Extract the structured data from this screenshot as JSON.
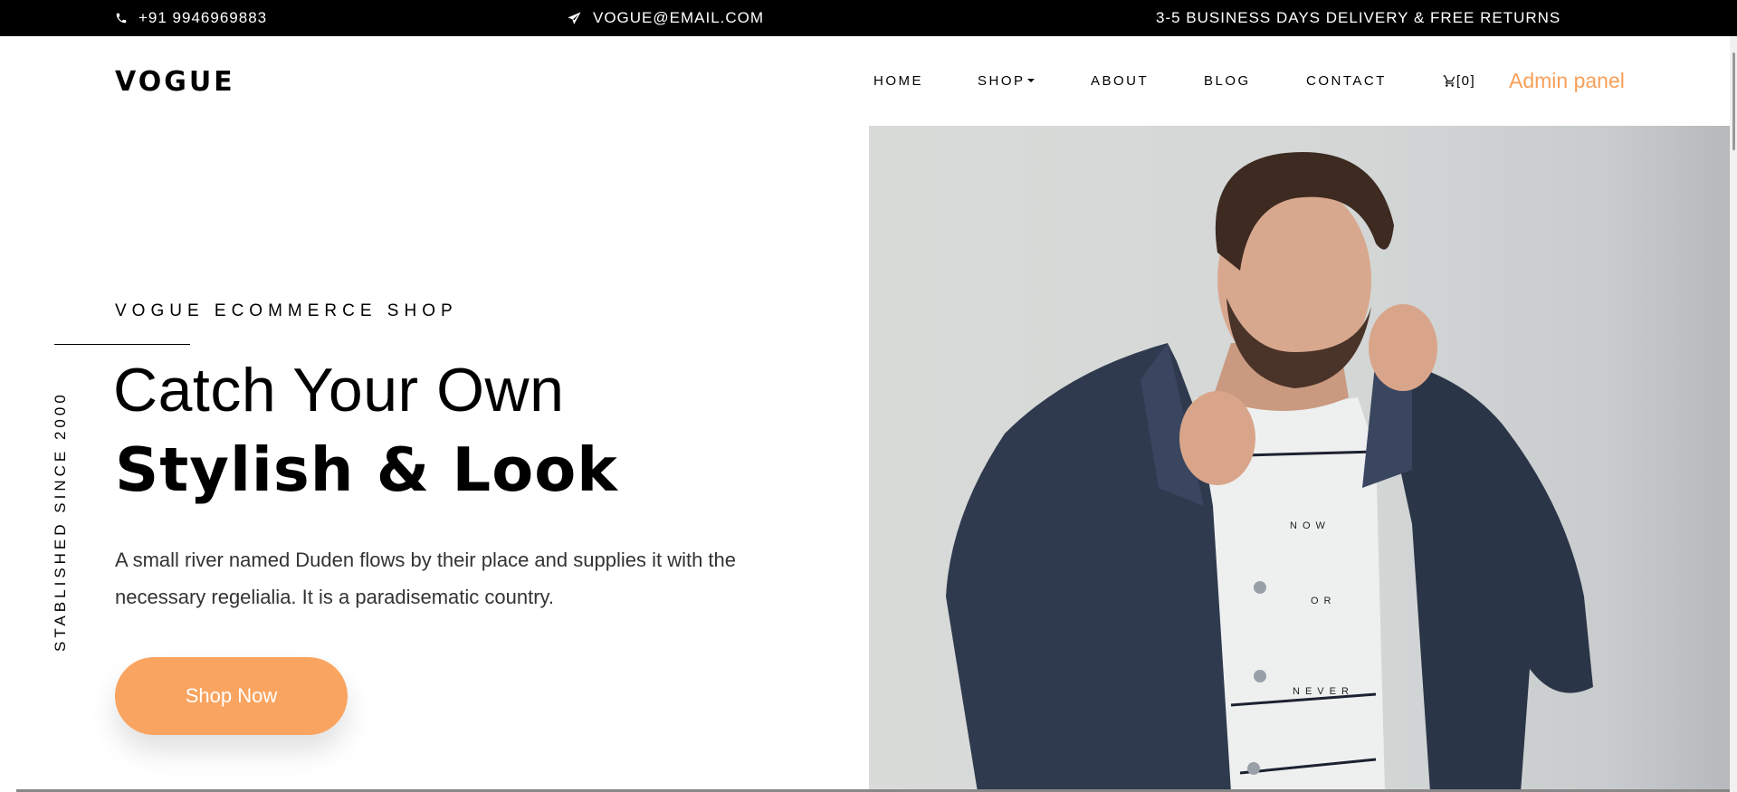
{
  "topbar": {
    "phone": "+91 9946969883",
    "email": "VOGUE@EMAIL.COM",
    "delivery": "3-5 BUSINESS DAYS DELIVERY & FREE RETURNS"
  },
  "header": {
    "logo": "VOGUE",
    "nav": {
      "home": "HOME",
      "shop": "SHOP",
      "about": "ABOUT",
      "blog": "BLOG",
      "contact": "CONTACT"
    },
    "cart_count": "[0]",
    "admin": "Admin panel"
  },
  "hero": {
    "vertical_text": "STABLISHED SINCE 2000",
    "kicker": "VOGUE ECOMMERCE SHOP",
    "title_line1": "Catch Your Own",
    "title_line2": "Stylish & Look",
    "description": "A small river named Duden flows by their place and supplies it with the necessary regelialia. It is a paradisematic country.",
    "button": "Shop Now",
    "tshirt_lines": [
      "NOW",
      "OR",
      "NEVER"
    ]
  },
  "colors": {
    "accent": "#f9a460",
    "admin_link": "#f79f59",
    "topbar_bg": "#000000"
  },
  "icons": [
    "phone-icon",
    "paper-plane-icon",
    "cart-icon",
    "chevron-down-icon"
  ]
}
